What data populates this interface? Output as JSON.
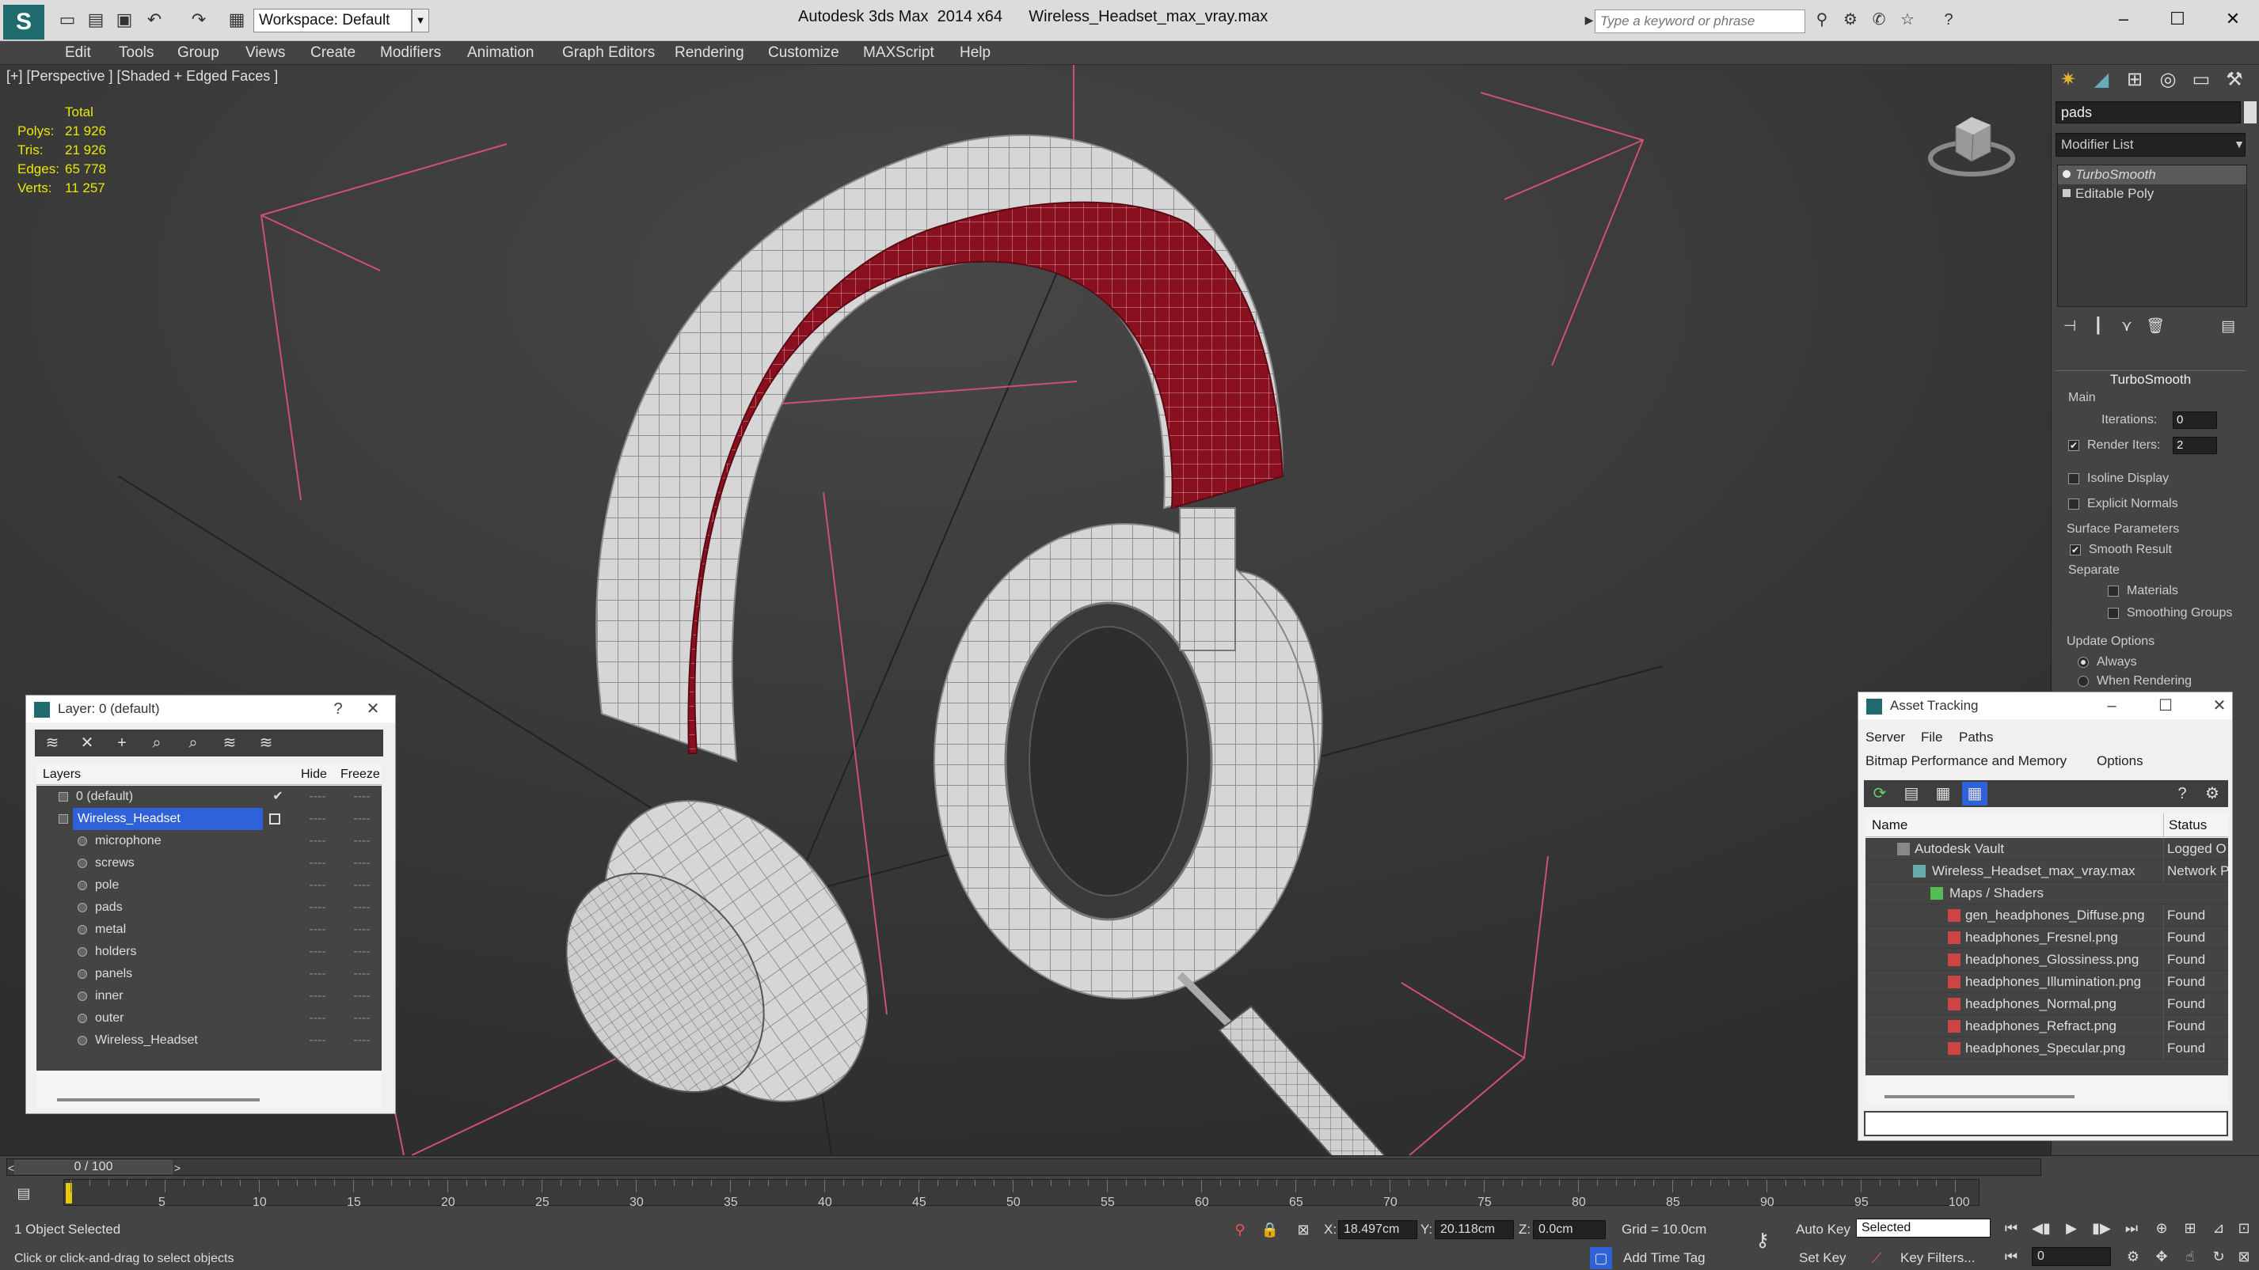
{
  "titlebar": {
    "workspace": "Workspace: Default",
    "app_title": "Autodesk 3ds Max  2014 x64      Wireless_Headset_max_vray.max",
    "search_placeholder": "Type a keyword or phrase"
  },
  "menu": [
    "Edit",
    "Tools",
    "Group",
    "Views",
    "Create",
    "Modifiers",
    "Animation",
    "Graph Editors",
    "Rendering",
    "Customize",
    "MAXScript",
    "Help"
  ],
  "viewport": {
    "label": "[+] [Perspective ] [Shaded + Edged Faces ]",
    "stats_header": "Total",
    "stats": [
      {
        "label": "Polys:",
        "value": "21 926"
      },
      {
        "label": "Tris:",
        "value": "21 926"
      },
      {
        "label": "Edges:",
        "value": "65 778"
      },
      {
        "label": "Verts:",
        "value": "11 257"
      }
    ]
  },
  "command_panel": {
    "object_name": "pads",
    "modifier_list": "Modifier List",
    "stack": [
      "TurboSmooth",
      "Editable Poly"
    ],
    "rollout_title": "TurboSmooth",
    "main_group": "Main",
    "iterations_label": "Iterations:",
    "iterations_value": "0",
    "render_iters_label": "Render Iters:",
    "render_iters_value": "2",
    "isoline_label": "Isoline Display",
    "explicit_normals_label": "Explicit Normals",
    "surface_params": "Surface Parameters",
    "smooth_result": "Smooth Result",
    "separate": "Separate",
    "materials": "Materials",
    "smoothing_groups": "Smoothing Groups",
    "update_options": "Update Options",
    "always": "Always",
    "when_rendering": "When Rendering"
  },
  "layer_dialog": {
    "title": "Layer: 0 (default)",
    "help": "?",
    "close": "✕",
    "col_layers": "Layers",
    "col_hide": "Hide",
    "col_freeze": "Freeze",
    "rows": [
      "0 (default)",
      "Wireless_Headset",
      "microphone",
      "screws",
      "pole",
      "pads",
      "metal",
      "holders",
      "panels",
      "inner",
      "outer",
      "Wireless_Headset"
    ],
    "dash": "----",
    "check": "✔"
  },
  "asset_tracking": {
    "title": "Asset Tracking",
    "menu1": [
      "Server",
      "File",
      "Paths"
    ],
    "menu2": [
      "Bitmap Performance and Memory",
      "Options"
    ],
    "col_name": "Name",
    "col_status": "Status",
    "rows": [
      {
        "name": "Autodesk Vault",
        "status": "Logged O"
      },
      {
        "name": "Wireless_Headset_max_vray.max",
        "status": "Network P"
      },
      {
        "name": "Maps / Shaders",
        "status": ""
      },
      {
        "name": "gen_headphones_Diffuse.png",
        "status": "Found"
      },
      {
        "name": "headphones_Fresnel.png",
        "status": "Found"
      },
      {
        "name": "headphones_Glossiness.png",
        "status": "Found"
      },
      {
        "name": "headphones_Illumination.png",
        "status": "Found"
      },
      {
        "name": "headphones_Normal.png",
        "status": "Found"
      },
      {
        "name": "headphones_Refract.png",
        "status": "Found"
      },
      {
        "name": "headphones_Specular.png",
        "status": "Found"
      }
    ]
  },
  "timeline": {
    "frame": "0 / 100",
    "ticks": [
      "5",
      "10",
      "15",
      "20",
      "25",
      "30",
      "35",
      "40",
      "45",
      "50",
      "55",
      "60",
      "65",
      "70",
      "75",
      "80",
      "85",
      "90",
      "95",
      "100"
    ]
  },
  "statusbar": {
    "selected": "1 Object Selected",
    "prompt": "Click or click-and-drag to select objects",
    "x_label": "X:",
    "x_value": "18.497cm",
    "y_label": "Y:",
    "y_value": "20.118cm",
    "z_label": "Z:",
    "z_value": "0.0cm",
    "grid": "Grid = 10.0cm",
    "add_time_tag": "Add Time Tag",
    "auto_key": "Auto Key",
    "set_key": "Set Key",
    "selected_dropdown": "Selected",
    "key_filters": "Key Filters...",
    "frame_field": "0"
  },
  "colors": {
    "accent_red": "#8a1020",
    "select_blue": "#2f62d8",
    "stats_yellow": "#e8e800"
  }
}
